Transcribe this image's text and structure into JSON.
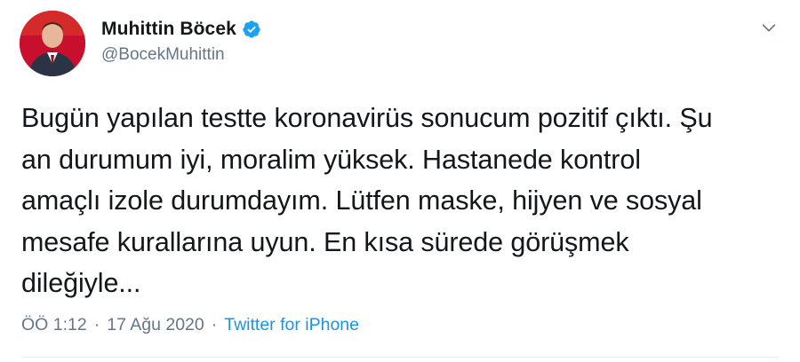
{
  "author": {
    "display_name": "Muhittin Böcek",
    "handle": "@BocekMuhittin",
    "verified": true,
    "avatar_icon": "profile-photo"
  },
  "tweet": {
    "text": "Bugün yapılan testte koronavirüs sonucum pozitif çıktı. Şu\nan durumum iyi, moralim yüksek. Hastanede kontrol\namaçlı izole durumdayım. Lütfen maske, hijyen ve sosyal\nmesafe kurallarına uyun. En kısa sürede görüşmek\ndileğiyle..."
  },
  "meta": {
    "time": "ÖÖ 1:12",
    "separator": "·",
    "date": "17 Ağu 2020",
    "source": "Twitter for iPhone"
  },
  "colors": {
    "text": "#14171a",
    "secondary": "#657786",
    "link": "#1b95e0",
    "verified": "#1da1f2"
  },
  "icons": {
    "verified": "verified-badge-icon",
    "menu": "chevron-down-icon"
  }
}
